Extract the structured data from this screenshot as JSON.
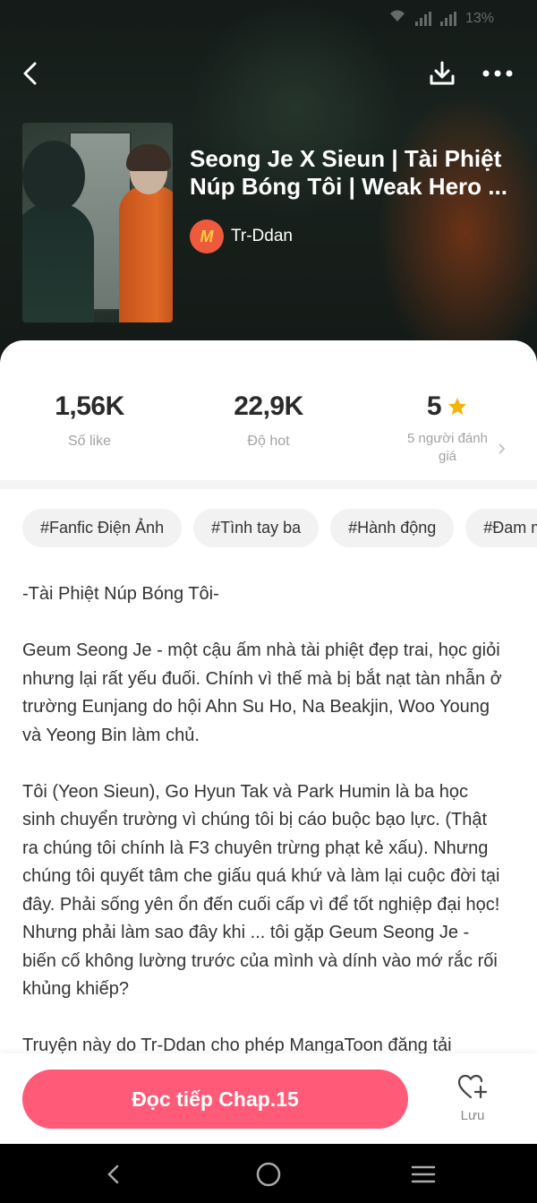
{
  "status": {
    "battery": "13%"
  },
  "book": {
    "title": "Seong Je X Sieun | Tài Phiệt Núp Bóng Tôi | Weak Hero ...",
    "author": "Tr-Ddan",
    "author_avatar_letter": "M"
  },
  "stats": [
    {
      "value": "1,56K",
      "label": "Số like"
    },
    {
      "value": "22,9K",
      "label": "Độ hot"
    },
    {
      "value": "5",
      "label": "5 người đánh giá"
    }
  ],
  "tags": [
    "#Fanfic Điện Ảnh",
    "#Tình tay ba",
    "#Hành động",
    "#Đam m"
  ],
  "description": [
    "-Tài Phiệt Núp Bóng Tôi-",
    "Geum Seong Je - một cậu ấm nhà tài phiệt đẹp trai, học giỏi nhưng lại rất yếu đuối. Chính vì thế mà bị bắt nạt tàn nhẫn ở trường Eunjang do hội Ahn Su Ho, Na Beakjin, Woo Young và Yeong Bin làm chủ.",
    "Tôi (Yeon Sieun), Go Hyun Tak và Park Humin là ba học sinh chuyển trường vì chúng tôi bị cáo buộc bạo lực. (Thật ra chúng tôi chính là F3 chuyên trừng phạt kẻ xấu). Nhưng chúng tôi quyết tâm che giấu quá khứ và làm lại cuộc đời tại đây. Phải sống yên ổn đến cuối cấp vì để tốt nghiệp đại học! Nhưng phải làm sao đây khi ... tôi gặp Geum Seong Je - biến cố không lường trước của mình và dính vào mớ rắc rối khủng khiếp?",
    "Truyện này do Tr-Ddan cho phép MangaToon đăng tải"
  ],
  "actions": {
    "read_label": "Đọc tiếp Chap.15",
    "save_label": "Lưu"
  },
  "colors": {
    "primary": "#ff5a78",
    "star": "#f5b400",
    "tag_bg": "#f2f2f2"
  },
  "icons": [
    "back-icon",
    "download-icon",
    "more-icon",
    "star-icon",
    "chevron-right-icon",
    "heart-plus-icon",
    "nav-back-icon",
    "nav-home-icon",
    "nav-menu-icon"
  ]
}
